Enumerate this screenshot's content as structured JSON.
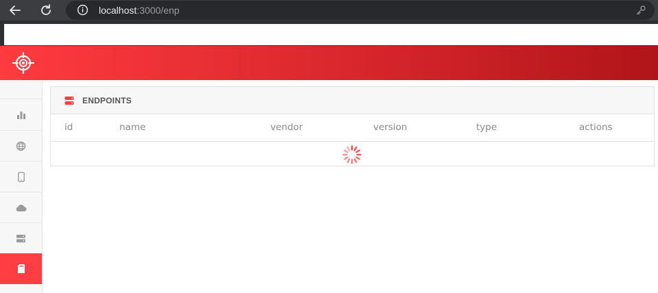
{
  "browser": {
    "url_host": "localhost",
    "url_path": ":3000/enp"
  },
  "icons": {
    "back": "back-arrow-icon",
    "reload": "reload-icon",
    "info": "info-icon",
    "key": "key-icon",
    "logo": "target-crosshair-icon"
  },
  "sidebar": {
    "items": [
      {
        "icon": "bar-chart-icon",
        "active": false
      },
      {
        "icon": "globe-icon",
        "active": false
      },
      {
        "icon": "mobile-phone-icon",
        "active": false
      },
      {
        "icon": "cloud-icon",
        "active": false
      },
      {
        "icon": "server-icon",
        "active": false
      },
      {
        "icon": "sd-card-icon",
        "active": true
      }
    ]
  },
  "panel": {
    "title": "ENDPOINTS",
    "columns": [
      "id",
      "name",
      "vendor",
      "version",
      "type",
      "actions"
    ],
    "loading": true
  },
  "colors": {
    "accent": "#ff3e43",
    "header_start": "#ff3b3f",
    "header_end": "#b01519"
  }
}
